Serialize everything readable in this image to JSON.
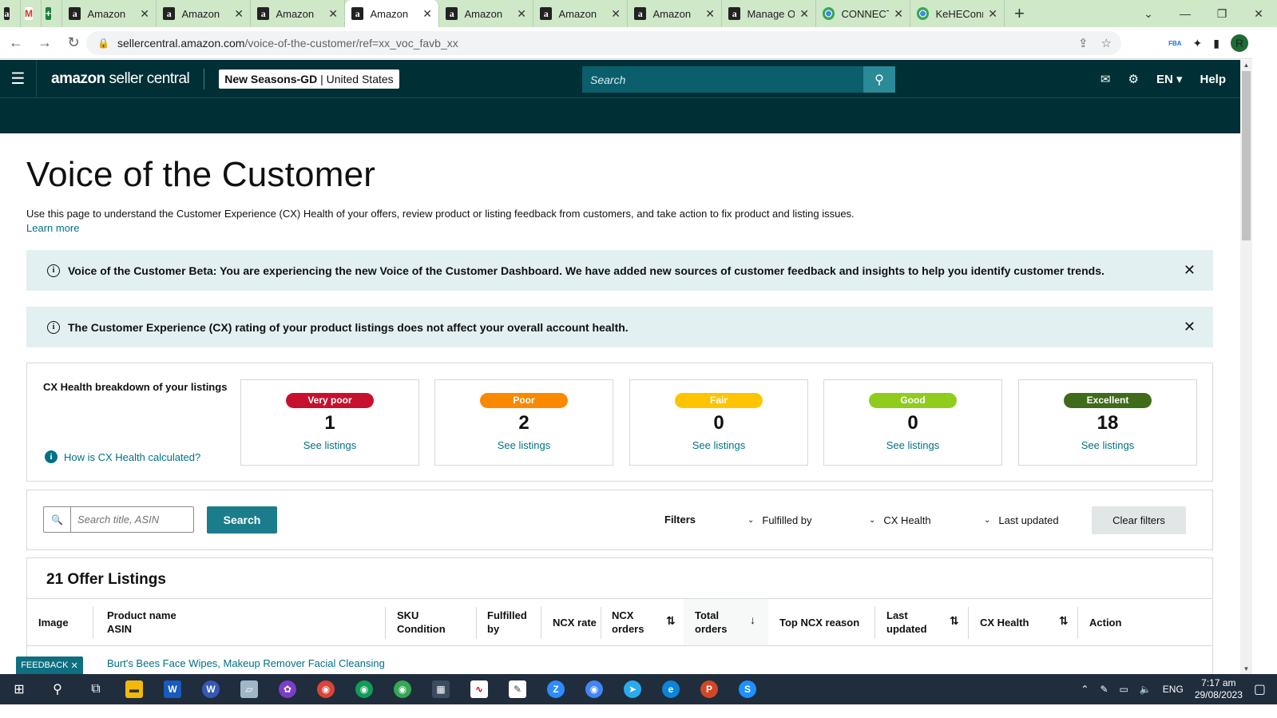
{
  "browser": {
    "tabs": [
      {
        "label": "",
        "icon": "amazon-icon"
      },
      {
        "label": "",
        "icon": "gmail-icon"
      },
      {
        "label": "",
        "icon": "plus-icon"
      },
      {
        "label": "Amazon",
        "icon": "amazon-icon"
      },
      {
        "label": "Amazon",
        "icon": "amazon-icon"
      },
      {
        "label": "Amazon",
        "icon": "amazon-icon"
      },
      {
        "label": "Amazon",
        "icon": "amazon-icon",
        "active": true
      },
      {
        "label": "Amazon",
        "icon": "amazon-icon"
      },
      {
        "label": "Amazon",
        "icon": "amazon-icon"
      },
      {
        "label": "Amazon",
        "icon": "amazon-icon"
      },
      {
        "label": "Manage O",
        "icon": "amazon-icon"
      },
      {
        "label": "CONNECT",
        "icon": "chrome-icon"
      },
      {
        "label": "KeHEConn",
        "icon": "chrome-icon"
      }
    ],
    "url_host": "sellercentral.amazon.com",
    "url_path": "/voice-of-the-customer/ref=xx_voc_favb_xx",
    "profile_initial": "R",
    "ext_badge": "FBA"
  },
  "header": {
    "brand_bold": "amazon",
    "brand_rest": " seller central",
    "store_name": "New Seasons-GD",
    "store_region": "United States",
    "search_placeholder": "Search",
    "language": "EN",
    "help": "Help"
  },
  "page": {
    "title": "Voice of the Customer",
    "intro": "Use this page to understand the Customer Experience (CX) Health of your offers, review product or listing feedback from customers, and take action to fix product and listing issues.",
    "learn_more": "Learn more",
    "alert1": "Voice of the Customer Beta: You are experiencing the new Voice of the Customer Dashboard. We have added new sources of customer feedback and insights to help you identify customer trends.",
    "alert2": "The Customer Experience (CX) rating of your product listings does not affect your overall account health."
  },
  "cx": {
    "title": "CX Health breakdown of your listings",
    "how_link": "How is CX Health calculated?",
    "cards": [
      {
        "label": "Very poor",
        "count": "1",
        "link": "See listings",
        "color": "#c7102e"
      },
      {
        "label": "Poor",
        "count": "2",
        "link": "See listings",
        "color": "#fa8900"
      },
      {
        "label": "Fair",
        "count": "0",
        "link": "See listings",
        "color": "#ffc400"
      },
      {
        "label": "Good",
        "count": "0",
        "link": "See listings",
        "color": "#8fcc1d"
      },
      {
        "label": "Excellent",
        "count": "18",
        "link": "See listings",
        "color": "#3f6b1a"
      }
    ]
  },
  "filters": {
    "search_placeholder": "Search title, ASIN",
    "search_button": "Search",
    "label": "Filters",
    "fulfilled_by": "Fulfilled by",
    "cx_health": "CX Health",
    "last_updated": "Last updated",
    "clear": "Clear filters"
  },
  "listings": {
    "title": "21 Offer Listings",
    "columns": {
      "image": "Image",
      "product_name": "Product name",
      "asin": "ASIN",
      "sku": "SKU",
      "condition": "Condition",
      "fulfilled_1": "Fulfilled",
      "fulfilled_2": "by",
      "ncx_rate": "NCX rate",
      "ncx_orders_1": "NCX",
      "ncx_orders_2": "orders",
      "total_orders_1": "Total",
      "total_orders_2": "orders",
      "top_ncx_reason": "Top NCX reason",
      "last_updated_1": "Last",
      "last_updated_2": "updated",
      "cx_health": "CX Health",
      "action": "Action"
    },
    "first_product": "Burt's Bees Face Wipes, Makeup Remover Facial Cleansing"
  },
  "feedback": "FEEDBACK",
  "taskbar": {
    "time": "7:17 am",
    "date": "29/08/2023",
    "lang": "ENG"
  }
}
